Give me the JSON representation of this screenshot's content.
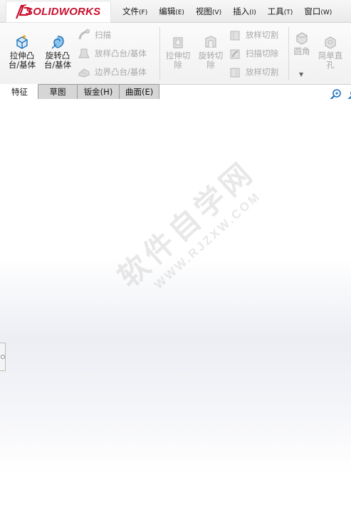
{
  "logo": {
    "prefix": "3S",
    "brand": "SOLIDWORKS"
  },
  "menu": [
    {
      "label": "文件",
      "key": "(F)"
    },
    {
      "label": "编辑",
      "key": "(E)"
    },
    {
      "label": "视图",
      "key": "(V)"
    },
    {
      "label": "插入",
      "key": "(I)"
    },
    {
      "label": "工具",
      "key": "(T)"
    },
    {
      "label": "窗口",
      "key": "(W)"
    }
  ],
  "ribbon": {
    "extrude_boss": {
      "line1": "拉伸凸",
      "line2": "台/基体"
    },
    "revolve_boss": {
      "line1": "旋转凸",
      "line2": "台/基体"
    },
    "sweep": "扫描",
    "loft_boss": "放样凸台/基体",
    "boundary_boss": "边界凸台/基体",
    "extrude_cut": {
      "line1": "拉伸切",
      "line2": "除"
    },
    "revolve_cut": {
      "line1": "旋转切",
      "line2": "除"
    },
    "loft_cut": "放样切割",
    "sweep_cut": "扫描切除",
    "loft_cut2": "放样切割",
    "fillet": "圆角",
    "simple_hole": {
      "line1": "简单直",
      "line2": "孔"
    }
  },
  "tabs": [
    {
      "label": "特征",
      "active": true
    },
    {
      "label": "草图",
      "active": false
    },
    {
      "label": "钣金(H)",
      "active": false
    },
    {
      "label": "曲面(E)",
      "active": false
    }
  ],
  "watermark": {
    "text": "软件自学网",
    "url": "WWW.RJZXW.COM"
  },
  "colors": {
    "brand_red": "#c8102e",
    "icon_blue": "#1e73be",
    "disabled_gray": "#a8a8a8",
    "tab_inactive": "#d6d6d6"
  },
  "icons": {
    "extrude_boss": "extrude-boss-icon",
    "revolve_boss": "revolve-boss-icon",
    "sweep": "sweep-icon",
    "loft": "loft-icon",
    "boundary": "boundary-icon",
    "extrude_cut": "extrude-cut-icon",
    "revolve_cut": "revolve-cut-icon",
    "fillet": "fillet-icon",
    "hole": "hole-icon",
    "zoom_fit": "zoom-fit-icon"
  }
}
